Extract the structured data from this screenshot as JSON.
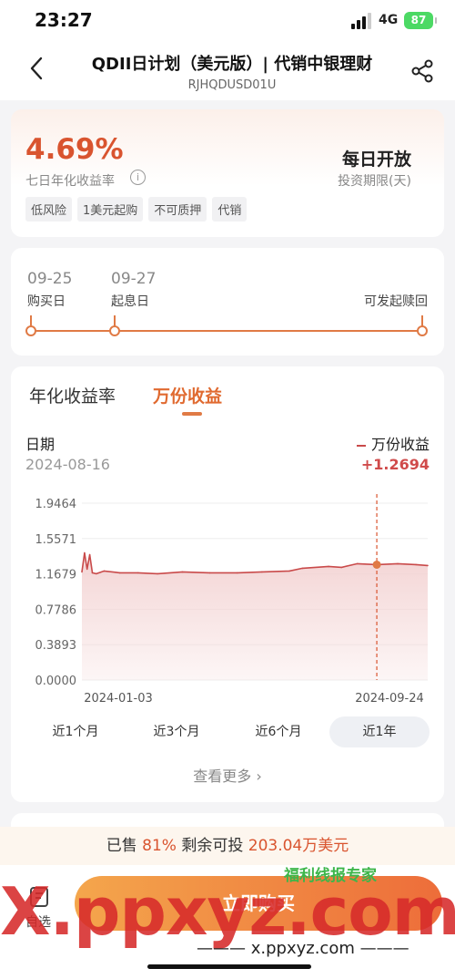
{
  "status_bar": {
    "time": "23:27",
    "network": "4G",
    "battery": "87"
  },
  "header": {
    "title": "QDII日计划（美元版）| 代销中银理财",
    "code": "RJHQDUSD01U"
  },
  "summary": {
    "rate": "4.69%",
    "rate_label": "七日年化收益率",
    "period_value": "每日开放",
    "period_label": "投资期限(天)",
    "tags": [
      "低风险",
      "1美元起购",
      "不可质押",
      "代销"
    ]
  },
  "timeline": {
    "buy_date": "09-25",
    "buy_label": "购买日",
    "interest_date": "09-27",
    "interest_label": "起息日",
    "redeem_label": "可发起赎回"
  },
  "chart_tabs": {
    "tab1": "年化收益率",
    "tab2": "万份收益"
  },
  "readout": {
    "date_label": "日期",
    "date_value": "2024-08-16",
    "legend": "万份收益",
    "value": "+1.2694"
  },
  "chart_data": {
    "type": "area",
    "y_ticks": [
      "1.9464",
      "1.5571",
      "1.1679",
      "0.7786",
      "0.3893",
      "0.0000"
    ],
    "ylim": [
      0,
      1.9464
    ],
    "x_ticks": [
      "2024-01-03",
      "2024-09-24"
    ],
    "x": [
      "2024-01-03",
      "2024-01-05",
      "2024-01-07",
      "2024-01-09",
      "2024-01-11",
      "2024-01-14",
      "2024-01-20",
      "2024-02-01",
      "2024-02-15",
      "2024-03-01",
      "2024-03-20",
      "2024-04-10",
      "2024-05-01",
      "2024-05-20",
      "2024-06-10",
      "2024-06-20",
      "2024-07-10",
      "2024-07-20",
      "2024-08-01",
      "2024-08-16",
      "2024-09-01",
      "2024-09-15",
      "2024-09-24"
    ],
    "values": [
      1.19,
      1.4,
      1.22,
      1.38,
      1.18,
      1.17,
      1.2,
      1.18,
      1.18,
      1.17,
      1.19,
      1.18,
      1.18,
      1.19,
      1.2,
      1.23,
      1.25,
      1.24,
      1.28,
      1.27,
      1.28,
      1.27,
      1.26
    ],
    "highlight_date": "2024-08-16",
    "highlight_value": 1.2694,
    "line_color": "#c94a4a",
    "fill_color": "#f3d2d2"
  },
  "ranges": {
    "r1": "近1个月",
    "r2": "近3个月",
    "r3": "近6个月",
    "r4": "近1年",
    "selected": "近1年"
  },
  "more_label": "查看更多",
  "sold_bar": {
    "prefix": "已售",
    "percent": "81%",
    "mid": "剩余可投",
    "amount": "203.04万美元"
  },
  "bottom": {
    "fav_label": "自选",
    "buy_label": "立即购买"
  },
  "watermark": {
    "main": "X.ppxyz.com",
    "badge": "福利线报专家",
    "footer": "x.ppxyz.com"
  },
  "colors": {
    "accent": "#e07a45",
    "rate": "#d9542f",
    "positive": "#d04b4b"
  }
}
